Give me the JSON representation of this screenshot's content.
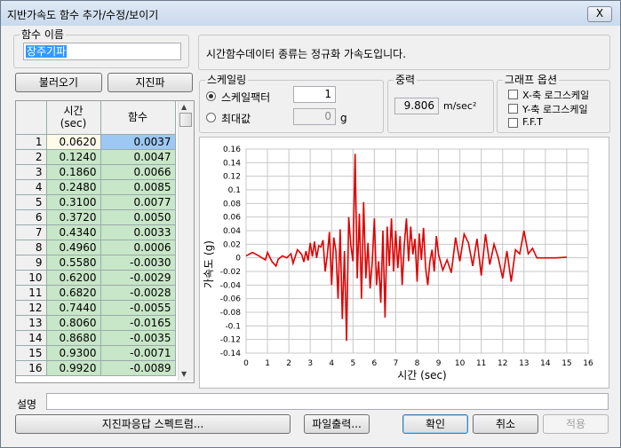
{
  "window": {
    "title": "지반가속도 함수 추가/수정/보이기",
    "close_label": "X"
  },
  "func_name": {
    "legend": "함수 이름",
    "value": "장주기파"
  },
  "info_text": "시간함수데이터 종류는 정규화 가속도입니다.",
  "buttons": {
    "load": "불러오기",
    "earthquake": "지진파"
  },
  "table": {
    "col_time": "시간\n(sec)",
    "col_func": "함수",
    "rows": [
      {
        "n": "1",
        "t": "0.0620",
        "v": "0.0037"
      },
      {
        "n": "2",
        "t": "0.1240",
        "v": "0.0047"
      },
      {
        "n": "3",
        "t": "0.1860",
        "v": "0.0066"
      },
      {
        "n": "4",
        "t": "0.2480",
        "v": "0.0085"
      },
      {
        "n": "5",
        "t": "0.3100",
        "v": "0.0077"
      },
      {
        "n": "6",
        "t": "0.3720",
        "v": "0.0050"
      },
      {
        "n": "7",
        "t": "0.4340",
        "v": "0.0033"
      },
      {
        "n": "8",
        "t": "0.4960",
        "v": "0.0006"
      },
      {
        "n": "9",
        "t": "0.5580",
        "v": "-0.0030"
      },
      {
        "n": "10",
        "t": "0.6200",
        "v": "-0.0029"
      },
      {
        "n": "11",
        "t": "0.6820",
        "v": "-0.0028"
      },
      {
        "n": "12",
        "t": "0.7440",
        "v": "-0.0055"
      },
      {
        "n": "13",
        "t": "0.8060",
        "v": "-0.0165"
      },
      {
        "n": "14",
        "t": "0.8680",
        "v": "-0.0035"
      },
      {
        "n": "15",
        "t": "0.9300",
        "v": "-0.0071"
      },
      {
        "n": "16",
        "t": "0.9920",
        "v": "-0.0089"
      }
    ]
  },
  "scaling": {
    "legend": "스케일링",
    "factor_label": "스케일팩터",
    "factor_value": "1",
    "max_label": "최대값",
    "max_value": "0",
    "max_unit": "g"
  },
  "gravity": {
    "legend": "중력",
    "value": "9.806",
    "unit": "m/sec²"
  },
  "graph_options": {
    "legend": "그래프 옵션",
    "x_log": "X-축 로그스케일",
    "y_log": "Y-축 로그스케일",
    "fft": "F.F.T"
  },
  "chart_data": {
    "type": "line",
    "xlabel": "시간 (sec)",
    "ylabel": "가속도 (g)",
    "xlim": [
      0,
      16
    ],
    "ylim": [
      -0.14,
      0.16
    ],
    "x_ticks": [
      "0",
      "1",
      "2",
      "3",
      "4",
      "5",
      "6",
      "7",
      "8",
      "9",
      "10",
      "11",
      "12",
      "13",
      "14",
      "15",
      "16"
    ],
    "y_ticks": [
      "0.16",
      "0.14",
      "0.12",
      "0.1",
      "0.08",
      "0.06",
      "0.04",
      "0.02",
      "0",
      "-0.02",
      "-0.04",
      "-0.06",
      "-0.08",
      "-0.1",
      "-0.12",
      "-0.14"
    ],
    "grid": true,
    "series_color": "#e00000",
    "x": [
      0,
      0.3,
      0.6,
      0.9,
      1.0,
      1.2,
      1.4,
      1.5,
      1.7,
      1.9,
      2.1,
      2.2,
      2.4,
      2.6,
      2.7,
      2.8,
      2.9,
      3.0,
      3.1,
      3.2,
      3.3,
      3.4,
      3.5,
      3.6,
      3.7,
      3.8,
      3.9,
      4.0,
      4.1,
      4.2,
      4.3,
      4.4,
      4.5,
      4.6,
      4.7,
      4.8,
      4.9,
      5.0,
      5.1,
      5.2,
      5.3,
      5.4,
      5.5,
      5.6,
      5.7,
      5.8,
      5.9,
      6.0,
      6.1,
      6.2,
      6.3,
      6.4,
      6.5,
      6.6,
      6.7,
      6.8,
      6.9,
      7.0,
      7.1,
      7.2,
      7.3,
      7.4,
      7.5,
      7.6,
      7.7,
      7.8,
      7.9,
      8.0,
      8.1,
      8.2,
      8.3,
      8.4,
      8.5,
      8.6,
      8.7,
      8.8,
      8.9,
      9.0,
      9.2,
      9.4,
      9.6,
      9.8,
      10.0,
      10.2,
      10.4,
      10.6,
      10.8,
      11.0,
      11.2,
      11.4,
      11.6,
      11.8,
      12.0,
      12.2,
      12.4,
      12.6,
      12.8,
      13.0,
      13.2,
      13.4,
      13.6,
      14.0,
      14.5,
      15.0
    ],
    "y": [
      0.003,
      0.008,
      0.003,
      -0.003,
      0.008,
      -0.005,
      -0.012,
      -0.002,
      0.003,
      0.0,
      0.006,
      -0.008,
      0.012,
      0.005,
      -0.006,
      0.01,
      -0.004,
      0.022,
      0.002,
      0.024,
      0.0,
      0.018,
      0.016,
      0.026,
      -0.02,
      0.004,
      0.038,
      -0.04,
      0.03,
      0.01,
      -0.06,
      0.042,
      -0.09,
      0.01,
      -0.122,
      0.06,
      0.018,
      -0.005,
      0.153,
      -0.03,
      0.065,
      -0.06,
      0.082,
      -0.03,
      0.022,
      -0.045,
      -0.006,
      0.058,
      -0.04,
      -0.005,
      -0.066,
      0.04,
      -0.088,
      0.046,
      -0.012,
      0.058,
      -0.02,
      0.04,
      -0.015,
      0.032,
      -0.04,
      0.02,
      0.058,
      -0.005,
      0.046,
      0.005,
      0.028,
      -0.035,
      0.036,
      -0.003,
      0.044,
      -0.015,
      -0.04,
      -0.005,
      0.012,
      -0.02,
      0.032,
      0.005,
      -0.018,
      -0.003,
      -0.022,
      0.03,
      -0.005,
      0.035,
      0.022,
      -0.012,
      0.028,
      -0.026,
      0.035,
      -0.01,
      0.02,
      0.0,
      -0.03,
      0.01,
      -0.035,
      0.012,
      0.006,
      0.04,
      0.006,
      0.014,
      0.0,
      0.0,
      0.0,
      0.001
    ]
  },
  "description": {
    "label": "설명",
    "value": ""
  },
  "bottom_buttons": {
    "spectrum": "지진파응답 스펙트럼...",
    "export": "파일출력...",
    "ok": "확인",
    "cancel": "취소",
    "apply": "적용"
  }
}
